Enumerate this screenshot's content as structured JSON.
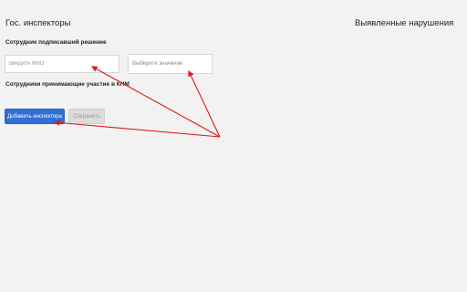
{
  "left_title": "Гос. инспекторы",
  "right_title": "Выявленные нарушения",
  "signer_label": "Сотрудник подписавший решение",
  "fio_input": {
    "value": "",
    "placeholder": "Введите ФИО"
  },
  "select": {
    "value": "Выберите значение"
  },
  "participants_label": "Сотрудники принимающие участие в КНМ",
  "buttons": {
    "add_inspector": "Добавить инспектора",
    "save": "Сохранить"
  },
  "colors": {
    "primary": "#2f6fd6",
    "annotation": "#e01818",
    "background": "#f2f2f2"
  }
}
